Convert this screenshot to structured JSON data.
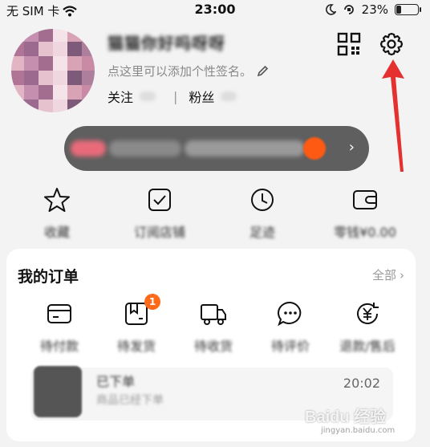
{
  "status_bar": {
    "carrier": "无 SIM 卡",
    "time": "23:00",
    "battery_text": "23%",
    "battery_level": 0.23
  },
  "profile": {
    "username": "猫猫你好吗呀呀",
    "signature_hint": "点这里可以添加个性签名。",
    "following_label": "关注",
    "followers_label": "粉丝"
  },
  "header_icons": {
    "qr": "qr-code-icon",
    "settings": "gear-icon"
  },
  "member_bar": {
    "text": "会员权益 · 开通会员享受专属福利"
  },
  "quick_actions": [
    {
      "label": "收藏",
      "icon": "star-icon"
    },
    {
      "label": "订阅店铺",
      "icon": "checkbox-icon"
    },
    {
      "label": "足迹",
      "icon": "clock-icon"
    },
    {
      "label": "零钱¥0.00",
      "icon": "wallet-icon"
    }
  ],
  "orders": {
    "title": "我的订单",
    "view_all": "全部",
    "items": [
      {
        "label": "待付款",
        "icon": "card-icon"
      },
      {
        "label": "待发货",
        "icon": "package-icon",
        "badge": "1"
      },
      {
        "label": "待收货",
        "icon": "truck-icon"
      },
      {
        "label": "待评价",
        "icon": "chat-icon"
      },
      {
        "label": "退款/售后",
        "icon": "refund-icon"
      }
    ],
    "recent": {
      "title": "已下单",
      "subtitle": "商品已经下单",
      "time": "20:02"
    }
  },
  "watermark": {
    "brand": "Baidu 经验",
    "url": "jingyan.baidu.com"
  },
  "colors": {
    "accent": "#ff6a1a",
    "annotation_arrow": "#e53030",
    "member_bar": "#5f5f5f"
  }
}
